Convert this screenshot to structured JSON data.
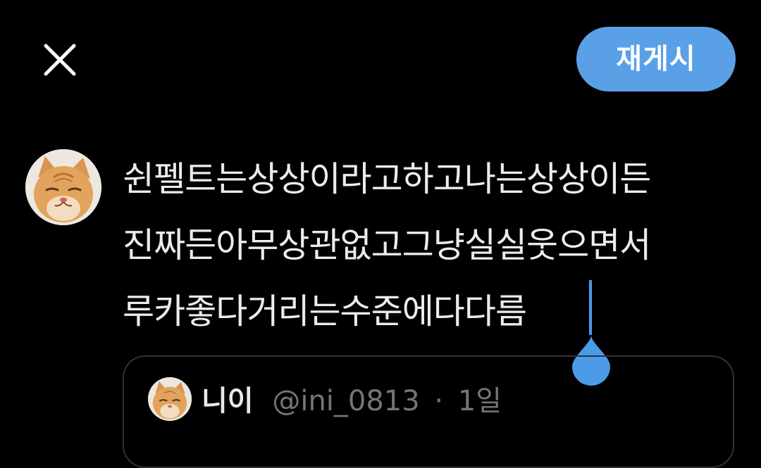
{
  "header": {
    "close_icon": "close-icon",
    "repost_label": "재게시"
  },
  "compose": {
    "avatar_icon": "cat-avatar",
    "text": "쉰펠트는상상이라고하고나는상상이든\n진짜든아무상관없고그냥실실웃으면서\n루카좋다거리는수준에다다름"
  },
  "quoted_post": {
    "avatar_icon": "cat-avatar",
    "display_name": "니이",
    "handle": "@ini_0813",
    "separator": "·",
    "time": "1일"
  },
  "colors": {
    "background": "#000000",
    "accent": "#5aa0e6",
    "text": "#ececec",
    "muted": "#71767b",
    "border": "#2f3336"
  }
}
